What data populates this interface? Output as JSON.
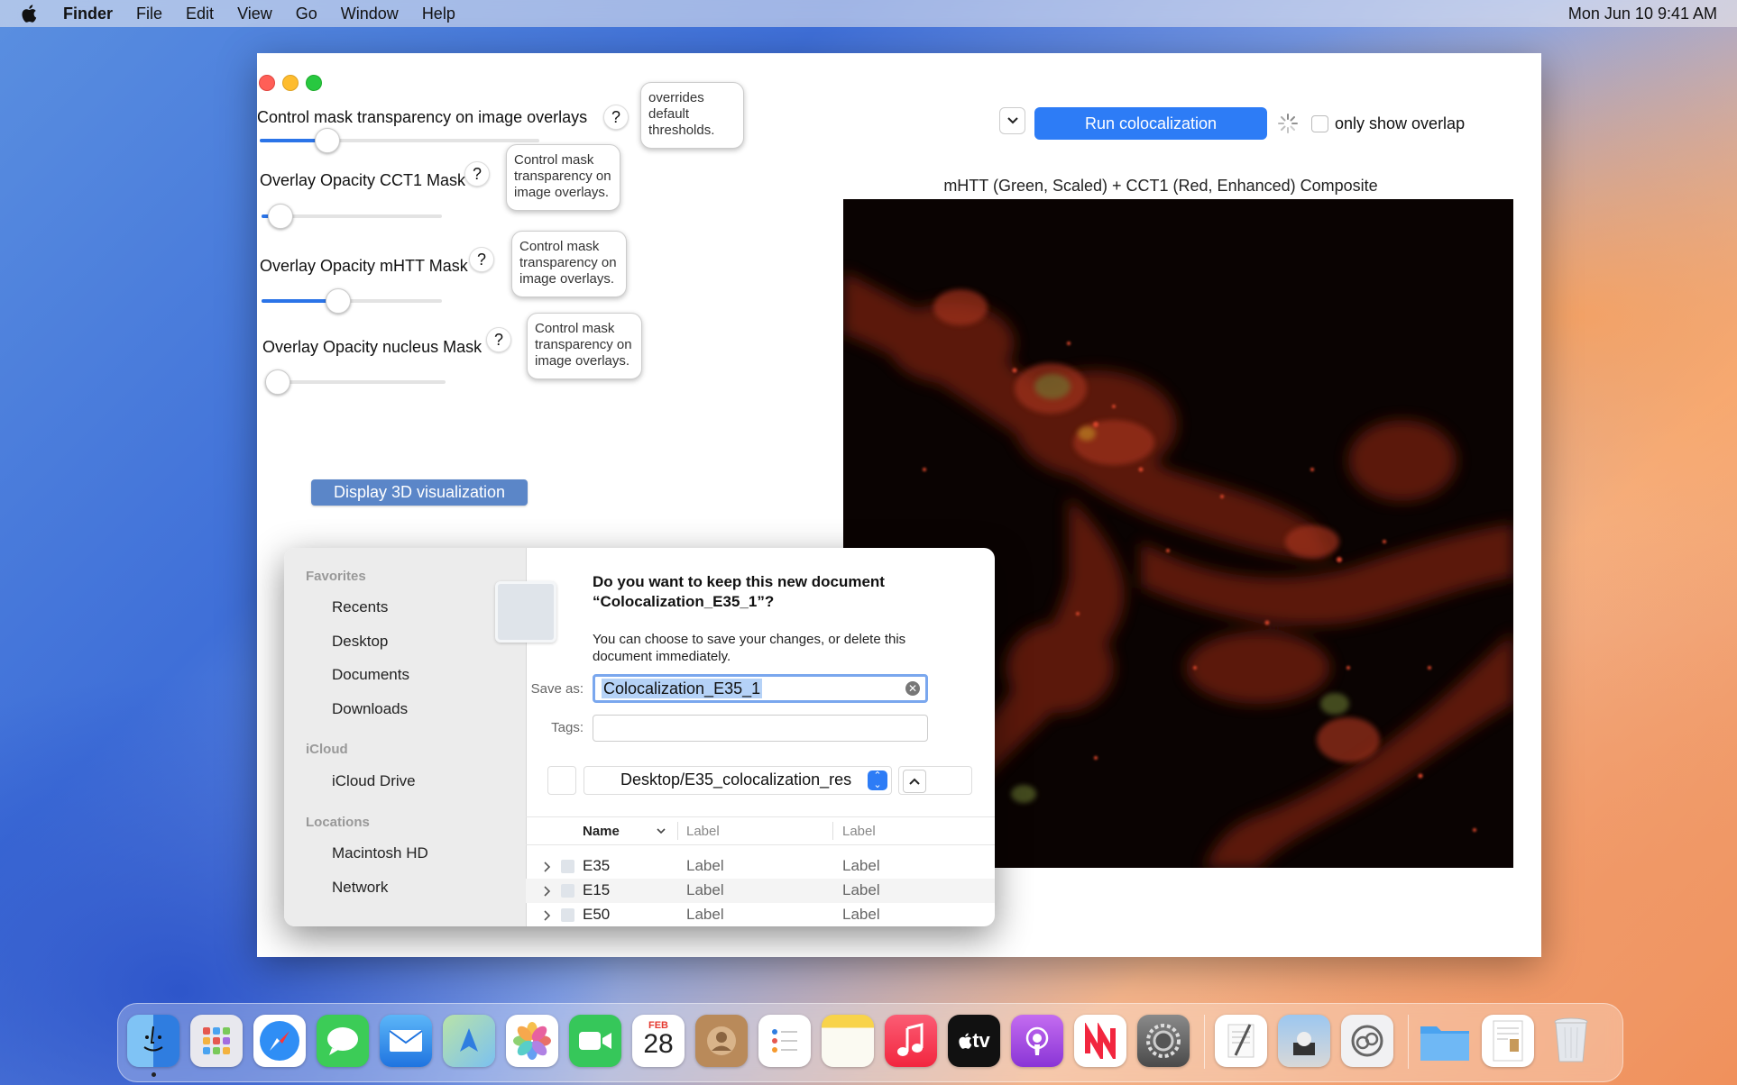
{
  "menubar": {
    "app": "Finder",
    "items": [
      "File",
      "Edit",
      "View",
      "Go",
      "Window",
      "Help"
    ],
    "clock": "Mon Jun 10  9:41 AM"
  },
  "controls": {
    "mask_transparency_label": "Control mask transparency on image overlays",
    "mask_transparency_value": 0.24,
    "mask_transparency_tip": "overrides default thresholds.",
    "cct1_label": "Overlay Opacity CCT1 Mask",
    "cct1_value": 0.1,
    "cct1_tip": "Control mask transparency on image overlays.",
    "mhtt_label": "Overlay Opacity mHTT Mask",
    "mhtt_value": 0.42,
    "mhtt_tip": "Control mask transparency on image overlays.",
    "nucleus_label": "Overlay Opacity nucleus Mask",
    "nucleus_value": 0.0,
    "nucleus_tip": "Control mask transparency on image overlays.",
    "help_glyph": "?",
    "display_3d_button": "Display 3D visualization"
  },
  "toolbar": {
    "run_button": "Run colocalization",
    "only_overlap_label": "only show overlap",
    "only_overlap_checked": false
  },
  "image": {
    "title": "mHTT (Green, Scaled) + CCT1 (Red, Enhanced) Composite"
  },
  "save_dialog": {
    "sidebar": {
      "favorites_header": "Favorites",
      "favorites": [
        "Recents",
        "Desktop",
        "Documents",
        "Downloads"
      ],
      "icloud_header": "iCloud",
      "icloud": [
        "iCloud Drive"
      ],
      "locations_header": "Locations",
      "locations": [
        "Macintosh HD",
        "Network"
      ]
    },
    "title": "Do you want to keep this new document “Colocalization_E35_1”?",
    "body": "You can choose to save your changes, or delete this document immediately.",
    "save_as_label": "Save as:",
    "save_as_value": "Colocalization_E35_1",
    "tags_label": "Tags:",
    "location": "Desktop/E35_colocalization_res",
    "columns": [
      "Name",
      "Label",
      "Label"
    ],
    "rows": [
      {
        "name": "E35",
        "c1": "Label",
        "c2": "Label"
      },
      {
        "name": "E15",
        "c1": "Label",
        "c2": "Label"
      },
      {
        "name": "E50",
        "c1": "Label",
        "c2": "Label"
      }
    ]
  },
  "dock": {
    "calendar_month": "FEB",
    "calendar_day": "28",
    "tv_label": "tv",
    "icons": [
      "finder-icon",
      "launchpad-icon",
      "safari-icon",
      "messages-icon",
      "mail-icon",
      "maps-icon",
      "photos-icon",
      "facetime-icon",
      "calendar-icon",
      "contacts-icon",
      "reminders-icon",
      "notes-icon",
      "music-icon",
      "tv-icon",
      "podcasts-icon",
      "news-icon",
      "system-settings-icon",
      "textedit-icon",
      "preview-icon",
      "screen-sharing-icon",
      "folder-icon",
      "document-icon",
      "trash-icon"
    ]
  }
}
